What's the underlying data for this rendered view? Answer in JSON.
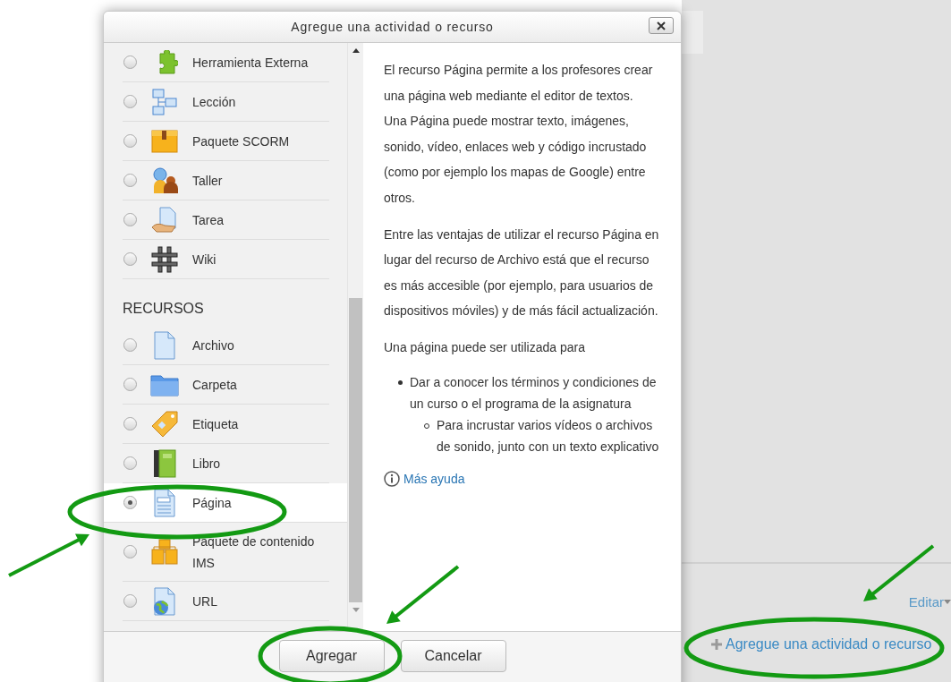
{
  "dialog": {
    "title": "Agregue una actividad o recurso",
    "activities": [
      {
        "label": "Herramienta Externa",
        "selected": false
      },
      {
        "label": "Lección",
        "selected": false
      },
      {
        "label": "Paquete SCORM",
        "selected": false
      },
      {
        "label": "Taller",
        "selected": false
      },
      {
        "label": "Tarea",
        "selected": false
      },
      {
        "label": "Wiki",
        "selected": false
      }
    ],
    "resources_heading": "RECURSOS",
    "resources": [
      {
        "label": "Archivo",
        "selected": false
      },
      {
        "label": "Carpeta",
        "selected": false
      },
      {
        "label": "Etiqueta",
        "selected": false
      },
      {
        "label": "Libro",
        "selected": false
      },
      {
        "label": "Página",
        "selected": true
      },
      {
        "label": "Paquete de contenido IMS",
        "selected": false
      },
      {
        "label": "URL",
        "selected": false
      }
    ],
    "description": {
      "paragraphs": [
        "El recurso Página permite a los profesores crear una página web mediante el editor de textos. Una Página puede mostrar texto, imágenes, sonido, vídeo, enlaces web y código incrustado (como por ejemplo los mapas de Google) entre otros.",
        "Entre las ventajas de utilizar el recurso Página en lugar del recurso de Archivo está que el recurso es más accesible (por ejemplo, para usuarios de dispositivos móviles) y de más fácil actualización.",
        "Una página puede ser utilizada para"
      ],
      "list": [
        {
          "text": "Dar a conocer los términos y condiciones de un curso o el programa de la asignatura",
          "children": [
            {
              "text": "Para incrustar varios vídeos o archivos de sonido, junto con un texto explicativo"
            }
          ]
        }
      ],
      "help_link": "Más ayuda"
    },
    "buttons": [
      "Agregar",
      "Cancelar"
    ]
  },
  "page": {
    "edit_menu": "Editar",
    "add_link": "Agregue una actividad o recurso"
  }
}
